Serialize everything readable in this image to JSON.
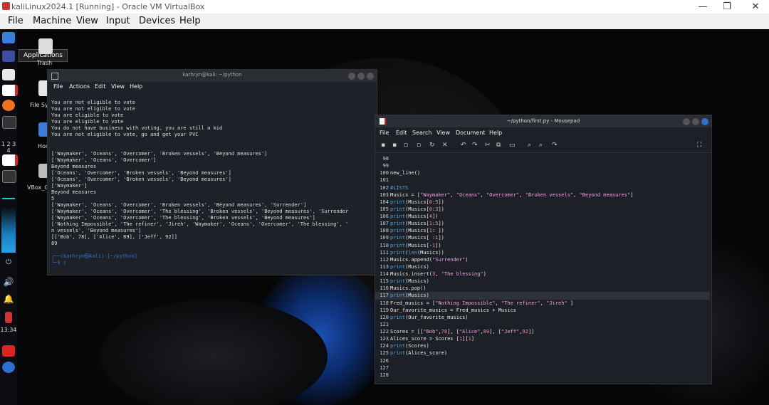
{
  "vbox": {
    "title": "kaliLinux2024.1 [Running] - Oracle VM VirtualBox",
    "menu": [
      "File",
      "Machine",
      "View",
      "Input",
      "Devices",
      "Help"
    ],
    "controls": {
      "minimize": "—",
      "restore": "❐",
      "close": "✕"
    }
  },
  "dock": {
    "workspaces": "1 2 3 4",
    "clock": "13:34",
    "tooltip": "Applications"
  },
  "desktop_icons": [
    {
      "label": "Trash"
    },
    {
      "label": "File Sy"
    },
    {
      "label": "Hor"
    },
    {
      "label": "VBox_G"
    }
  ],
  "terminal": {
    "title": "kathryn@kali: ~/python",
    "menu": [
      "File",
      "Actions",
      "Edit",
      "View",
      "Help"
    ],
    "output": [
      "You are not eligible to vote",
      "You are not eligible to vote",
      "You are eligible to vote",
      "You are eligible to vote",
      "You do not have business with voting, you are still a kid",
      "You are not eligible to vote, go and get your PVC",
      "",
      "",
      "['Waymaker', 'Oceans', 'Overcomer', 'Broken vessels', 'Beyond measures']",
      "['Waymaker', 'Oceans', 'Overcomer']",
      "Beyond measures",
      "['Oceans', 'Overcomer', 'Broken vessels', 'Beyond measures']",
      "['Oceans', 'Overcomer', 'Broken vessels', 'Beyond measures']",
      "['Waymaker']",
      "Beyond measures",
      "5",
      "['Waymaker', 'Oceans', 'Overcomer', 'Broken vessels', 'Beyond measures', 'Surrender']",
      "['Waymaker', 'Oceans', 'Overcomer', 'The blessing', 'Broken vessels', 'Beyond measures', 'Surrender",
      "['Waymaker', 'Oceans', 'Overcomer', 'The blessing', 'Broken vessels', 'Beyond measures']",
      "['Nothing Impossible', 'The refiner', 'Jireh', 'Waymaker', 'Oceans', 'Overcomer', 'The blessing', '",
      "n vessels', 'Beyond measures']",
      "[['Bob', 78], ['Alice', 89], ['Jeff', 92]]",
      "89"
    ],
    "prompt_user": "┌──(kathryn㉿kali)-[~/python]",
    "prompt_line": "└─$ ▯"
  },
  "editor": {
    "title": "~/python/first.py - Mousepad",
    "menu": [
      "File",
      "Edit",
      "Search",
      "View",
      "Document",
      "Help"
    ],
    "lines": [
      {
        "n": "98",
        "code": ""
      },
      {
        "n": "99",
        "code": ""
      },
      {
        "n": "100",
        "code": "new_line()"
      },
      {
        "n": "101",
        "code": ""
      },
      {
        "n": "102",
        "code": "#LISTS"
      },
      {
        "n": "103",
        "code": "Musics = [\"Waymaker\", \"Oceans\", \"Overcomer\", \"Broken vessels\", \"Beyond measures\"]"
      },
      {
        "n": "104",
        "code": "print(Musics[0:5])"
      },
      {
        "n": "105",
        "code": "print(Musics[0:3])"
      },
      {
        "n": "106",
        "code": "print(Musics[4])"
      },
      {
        "n": "107",
        "code": "print(Musics[1:5])"
      },
      {
        "n": "108",
        "code": "print(Musics[1: ])"
      },
      {
        "n": "109",
        "code": "print(Musics[ :1])"
      },
      {
        "n": "110",
        "code": "print(Musics[-1])"
      },
      {
        "n": "111",
        "code": "print(len(Musics))"
      },
      {
        "n": "112",
        "code": "Musics.append(\"Surrender\")"
      },
      {
        "n": "113",
        "code": "print(Musics)"
      },
      {
        "n": "114",
        "code": "Musics.insert(3, \"The blessing\")"
      },
      {
        "n": "115",
        "code": "print(Musics)"
      },
      {
        "n": "116",
        "code": "Musics.pop()"
      },
      {
        "n": "117",
        "code": "print(Musics)"
      },
      {
        "n": "118",
        "code": "Fred_musics = [\"Nothing Impossible\", \"The refiner\", \"Jireh\" ]"
      },
      {
        "n": "119",
        "code": "Our_favorite_musics = Fred_musics + Musics"
      },
      {
        "n": "120",
        "code": "print(Our_favorite_musics)"
      },
      {
        "n": "121",
        "code": ""
      },
      {
        "n": "122",
        "code": "Scores = [[\"Bob\",78], [\"Alice\",89], [\"Jeff\",92]]"
      },
      {
        "n": "123",
        "code": "Alices_score = Scores [1][1]"
      },
      {
        "n": "124",
        "code": "print(Scores)"
      },
      {
        "n": "125",
        "code": "print(Alices_score)"
      },
      {
        "n": "126",
        "code": ""
      },
      {
        "n": "127",
        "code": ""
      },
      {
        "n": "128",
        "code": ""
      }
    ],
    "current_line": "117"
  }
}
